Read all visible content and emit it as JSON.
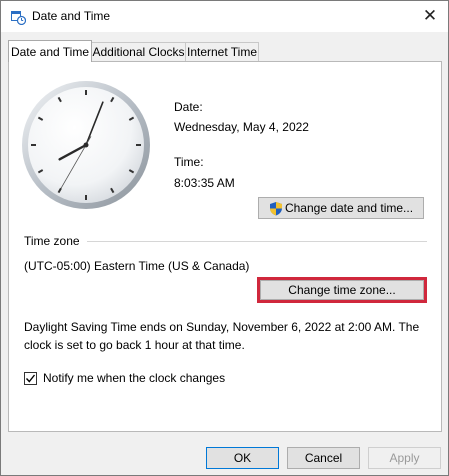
{
  "window": {
    "title": "Date and Time",
    "close_glyph": "✕",
    "colors": {
      "titlebar": "#ffffff",
      "dialog_bg": "#f0f0f0",
      "highlight": "#d0283c",
      "focus": "#0078d7"
    }
  },
  "tabs": [
    {
      "label": "Date and Time",
      "active": true
    },
    {
      "label": "Additional Clocks",
      "active": false
    },
    {
      "label": "Internet Time",
      "active": false
    }
  ],
  "clock": {
    "hour": 8,
    "minute": 3,
    "second": 35
  },
  "date": {
    "heading": "Date:",
    "value": "Wednesday, May 4, 2022"
  },
  "time": {
    "heading": "Time:",
    "value": "8:03:35 AM"
  },
  "change_date_button": {
    "label": "Change date and time...",
    "icon": "uac-shield-icon"
  },
  "time_zone": {
    "heading": "Time zone",
    "value": "(UTC-05:00) Eastern Time (US & Canada)",
    "button": "Change time zone..."
  },
  "dst_info": {
    "line1": "Daylight Saving Time ends on Sunday, November 6, 2022 at 2:00 AM. The",
    "line2": "clock is set to go back 1 hour at that time."
  },
  "notify": {
    "label": "Notify me when the clock changes",
    "checked": true
  },
  "footer": {
    "ok": "OK",
    "cancel": "Cancel",
    "apply": "Apply"
  }
}
